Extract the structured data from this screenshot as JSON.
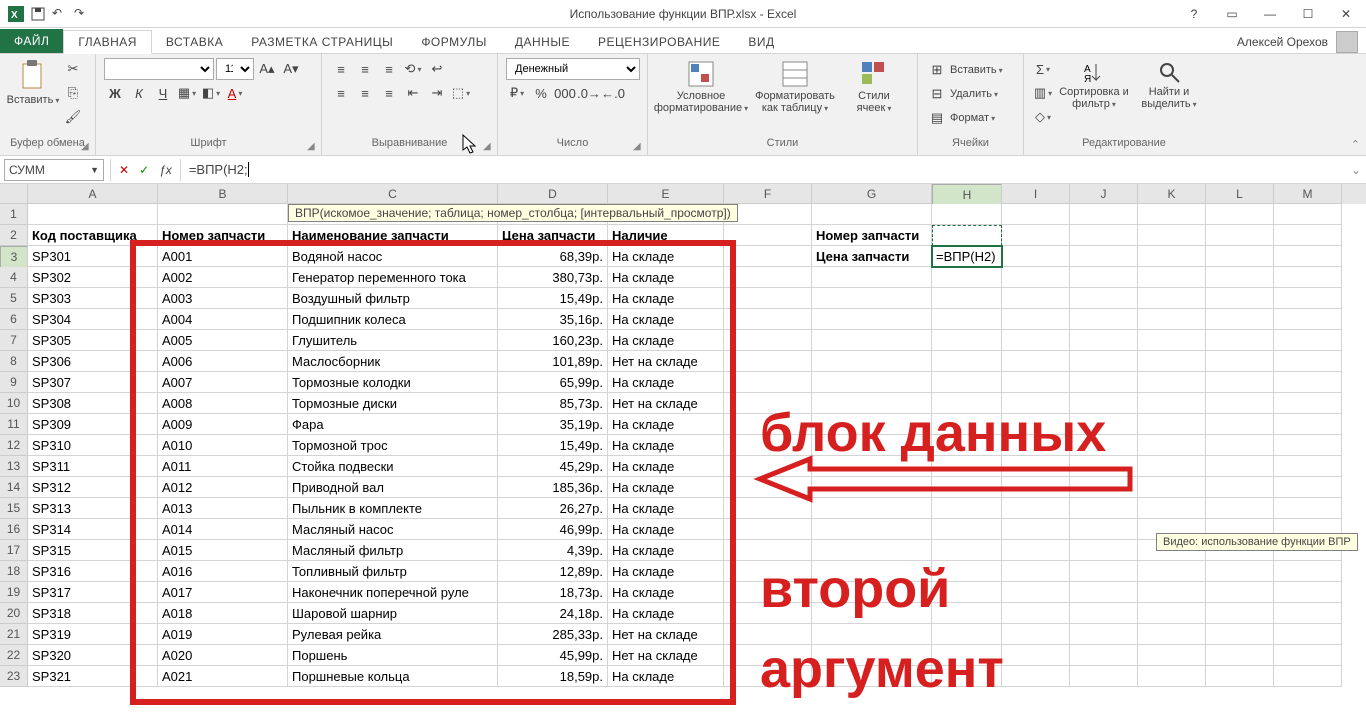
{
  "title": "Использование функции ВПР.xlsx - Excel",
  "user": "Алексей Орехов",
  "tabs": {
    "file": "ФАЙЛ",
    "list": [
      "ГЛАВНАЯ",
      "ВСТАВКА",
      "РАЗМЕТКА СТРАНИЦЫ",
      "ФОРМУЛЫ",
      "ДАННЫЕ",
      "РЕЦЕНЗИРОВАНИЕ",
      "ВИД"
    ],
    "active_index": 0
  },
  "ribbon": {
    "clipboard": {
      "paste": "Вставить",
      "title": "Буфер обмена"
    },
    "font": {
      "title": "Шрифт",
      "size": "11"
    },
    "align": {
      "title": "Выравнивание"
    },
    "number": {
      "title": "Число",
      "format": "Денежный"
    },
    "styles": {
      "title": "Стили",
      "cond": "Условное форматирование",
      "table": "Форматировать как таблицу",
      "cell": "Стили ячеек"
    },
    "cells": {
      "title": "Ячейки",
      "insert": "Вставить",
      "delete": "Удалить",
      "format": "Формат"
    },
    "editing": {
      "title": "Редактирование",
      "sort": "Сортировка и фильтр",
      "find": "Найти и выделить"
    }
  },
  "formula_bar": {
    "namebox": "СУММ",
    "fx": "ƒx",
    "value": "=ВПР(H2;"
  },
  "fn_tooltip": "ВПР(искомое_значение; таблица; номер_столбца; [интервальный_просмотр])",
  "columns": [
    "A",
    "B",
    "C",
    "D",
    "E",
    "F",
    "G",
    "H",
    "I",
    "J",
    "K",
    "L",
    "M"
  ],
  "active_col": "H",
  "active_row": 3,
  "headers": {
    "A": "Код поставщика",
    "B": "Номер запчасти",
    "C": "Наименование запчасти",
    "D": "Цена запчасти",
    "E": "Наличие"
  },
  "side_labels": {
    "g2": "Номер запчасти",
    "g3": "Цена запчасти",
    "h3": "=ВПР(H2)"
  },
  "rows": [
    {
      "a": "SP301",
      "b": "A001",
      "c": "Водяной насос",
      "d": "68,39р.",
      "e": "На складе"
    },
    {
      "a": "SP302",
      "b": "A002",
      "c": "Генератор переменного тока",
      "d": "380,73р.",
      "e": "На складе"
    },
    {
      "a": "SP303",
      "b": "A003",
      "c": "Воздушный фильтр",
      "d": "15,49р.",
      "e": "На складе"
    },
    {
      "a": "SP304",
      "b": "A004",
      "c": "Подшипник колеса",
      "d": "35,16р.",
      "e": "На складе"
    },
    {
      "a": "SP305",
      "b": "A005",
      "c": "Глушитель",
      "d": "160,23р.",
      "e": "На складе"
    },
    {
      "a": "SP306",
      "b": "A006",
      "c": "Маслосборник",
      "d": "101,89р.",
      "e": "Нет на складе"
    },
    {
      "a": "SP307",
      "b": "A007",
      "c": "Тормозные колодки",
      "d": "65,99р.",
      "e": "На складе"
    },
    {
      "a": "SP308",
      "b": "A008",
      "c": "Тормозные диски",
      "d": "85,73р.",
      "e": "Нет на складе"
    },
    {
      "a": "SP309",
      "b": "A009",
      "c": "Фара",
      "d": "35,19р.",
      "e": "На складе"
    },
    {
      "a": "SP310",
      "b": "A010",
      "c": "Тормозной трос",
      "d": "15,49р.",
      "e": "На складе"
    },
    {
      "a": "SP311",
      "b": "A011",
      "c": "Стойка подвески",
      "d": "45,29р.",
      "e": "На складе"
    },
    {
      "a": "SP312",
      "b": "A012",
      "c": "Приводной вал",
      "d": "185,36р.",
      "e": "На складе"
    },
    {
      "a": "SP313",
      "b": "A013",
      "c": "Пыльник в комплекте",
      "d": "26,27р.",
      "e": "На складе"
    },
    {
      "a": "SP314",
      "b": "A014",
      "c": "Масляный насос",
      "d": "46,99р.",
      "e": "На складе"
    },
    {
      "a": "SP315",
      "b": "A015",
      "c": "Масляный фильтр",
      "d": "4,39р.",
      "e": "На складе"
    },
    {
      "a": "SP316",
      "b": "A016",
      "c": "Топливный фильтр",
      "d": "12,89р.",
      "e": "На складе"
    },
    {
      "a": "SP317",
      "b": "A017",
      "c": "Наконечник поперечной руле",
      "d": "18,73р.",
      "e": "На складе"
    },
    {
      "a": "SP318",
      "b": "A018",
      "c": "Шаровой шарнир",
      "d": "24,18р.",
      "e": "На складе"
    },
    {
      "a": "SP319",
      "b": "A019",
      "c": "Рулевая рейка",
      "d": "285,33р.",
      "e": "Нет на складе"
    },
    {
      "a": "SP320",
      "b": "A020",
      "c": "Поршень",
      "d": "45,99р.",
      "e": "Нет на складе"
    },
    {
      "a": "SP321",
      "b": "A021",
      "c": "Поршневые кольца",
      "d": "18,59р.",
      "e": "На складе"
    }
  ],
  "annotations": {
    "l1": "блок данных",
    "l2": "второй",
    "l3": "аргумент"
  },
  "video_tip": "Видео: использование функции ВПР"
}
